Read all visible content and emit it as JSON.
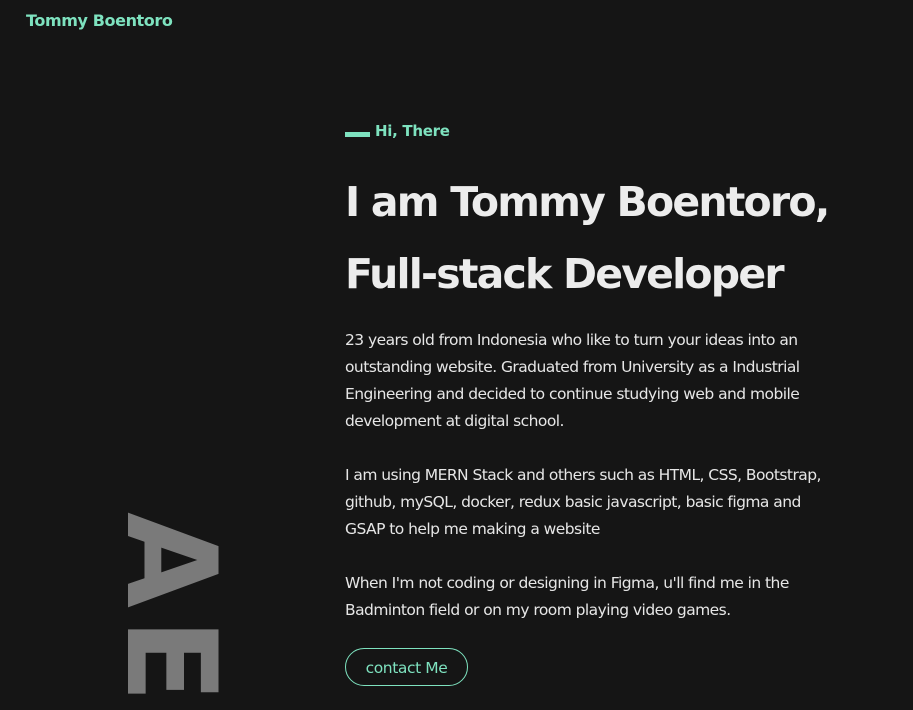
{
  "header": {
    "brand": "Tommy Boentoro"
  },
  "decor": {
    "vertical_text": "AE"
  },
  "hero": {
    "greeting": "Hi, There",
    "headline_line1": "I am Tommy Boentoro,",
    "headline_line2": "Full-stack Developer",
    "paragraph1": "23 years old from Indonesia who like to turn your ideas into an outstanding website. Graduated from University as a Industrial Engineering and decided to continue studying web and mobile development at digital school.",
    "paragraph2": "I am using MERN Stack and others such as HTML, CSS, Bootstrap, github, mySQL, docker, redux basic javascript, basic figma and GSAP to help me making a website",
    "paragraph3": "When I'm not coding or designing in Figma, u'll find me in the Badminton field or on my room playing video games.",
    "contact_label": "contact Me"
  },
  "colors": {
    "background": "#151515",
    "accent": "#7ee2bf",
    "text": "#ececec",
    "decor": "#7a7a7a"
  }
}
